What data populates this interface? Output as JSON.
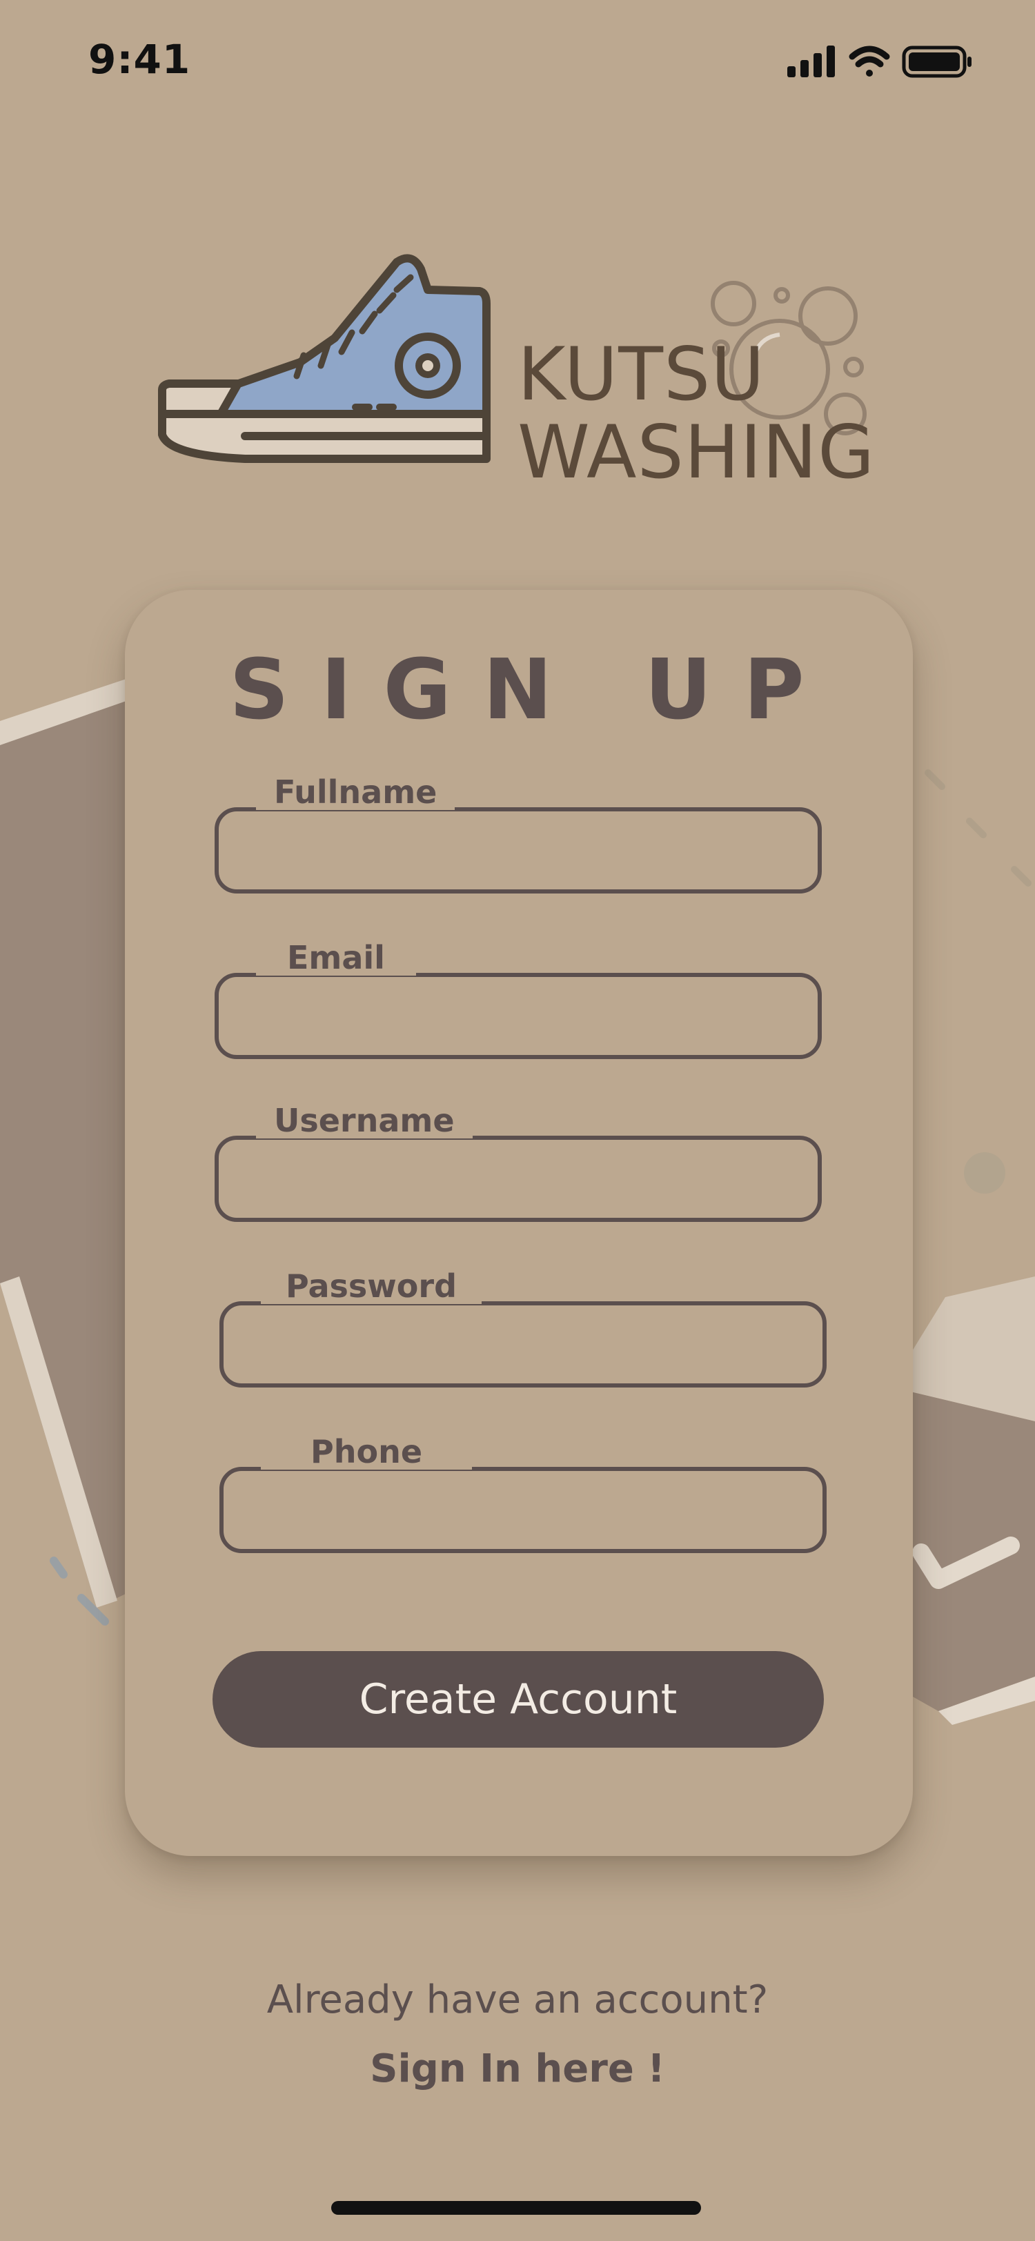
{
  "status_bar": {
    "time": "9:41",
    "icons": [
      "cellular-signal-icon",
      "wifi-icon",
      "battery-icon"
    ]
  },
  "logo": {
    "line1": "KUTSU",
    "line2": "WASHING",
    "icons": [
      "sneaker-icon",
      "bubbles-icon"
    ]
  },
  "form": {
    "title": "SIGN UP",
    "fields": [
      {
        "label": "Fullname",
        "value": ""
      },
      {
        "label": "Email",
        "value": ""
      },
      {
        "label": "Username",
        "value": ""
      },
      {
        "label": "Password",
        "value": ""
      },
      {
        "label": "Phone",
        "value": ""
      }
    ],
    "submit_label": "Create Account"
  },
  "footer": {
    "prompt": "Already have an account?",
    "signin_label": "Sign In here !"
  },
  "colors": {
    "background": "#bca890",
    "text": "#5b4f4e",
    "button": "#5b4f4e",
    "button_text": "#f3ece4",
    "logo_text": "#5b4a3a",
    "sneaker_blue": "#7f9cc0"
  }
}
